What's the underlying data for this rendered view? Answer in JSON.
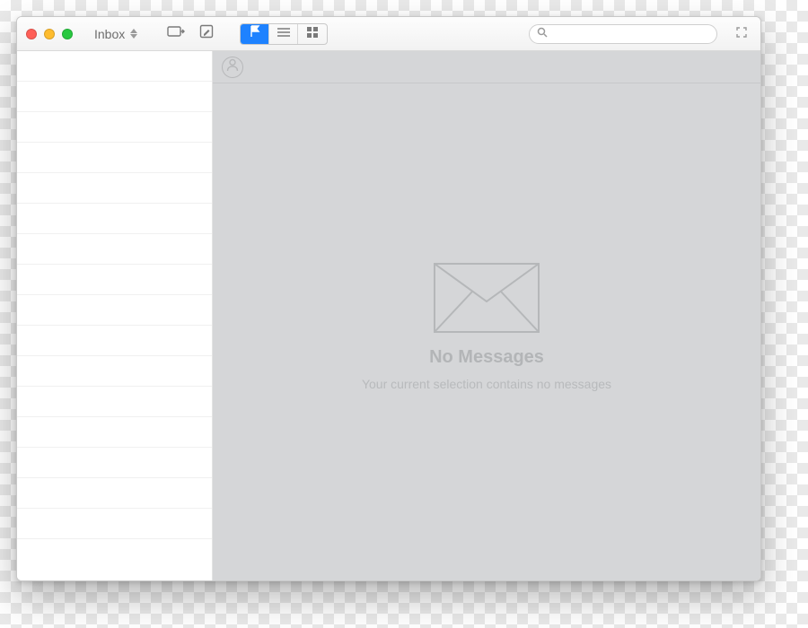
{
  "toolbar": {
    "mailbox_label": "Inbox",
    "search_placeholder": ""
  },
  "content": {
    "empty_title": "No Messages",
    "empty_subtitle": "Your current selection contains no messages"
  },
  "icons": {
    "close": "close-icon",
    "minimize": "minimize-icon",
    "zoom": "zoom-icon",
    "stepper": "stepper-icon",
    "receive": "receive-mail-icon",
    "compose": "compose-icon",
    "flag": "flag-icon",
    "list": "list-view-icon",
    "grid": "grid-view-icon",
    "search": "search-icon",
    "fullscreen": "fullscreen-icon",
    "avatar": "person-icon",
    "envelope": "envelope-icon"
  }
}
